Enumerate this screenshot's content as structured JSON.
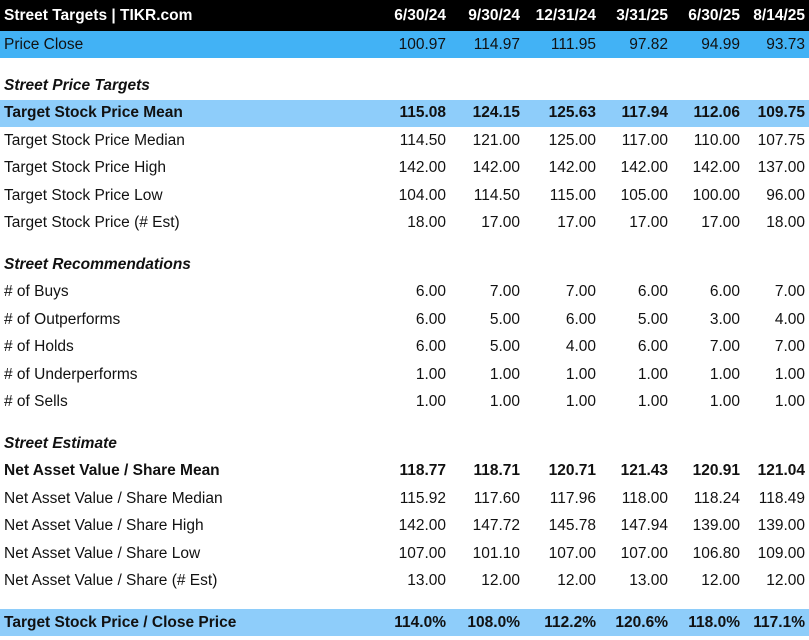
{
  "header": {
    "title": "Street Targets | TIKR.com",
    "dates": [
      "6/30/24",
      "9/30/24",
      "12/31/24",
      "3/31/25",
      "6/30/25",
      "8/14/25"
    ]
  },
  "price_close": {
    "label": "Price Close",
    "values": [
      "100.97",
      "114.97",
      "111.95",
      "97.82",
      "94.99",
      "93.73"
    ]
  },
  "price_targets": {
    "title": "Street Price Targets",
    "rows": [
      {
        "label": "Target Stock Price Mean",
        "values": [
          "115.08",
          "124.15",
          "125.63",
          "117.94",
          "112.06",
          "109.75"
        ]
      },
      {
        "label": "Target Stock Price Median",
        "values": [
          "114.50",
          "121.00",
          "125.00",
          "117.00",
          "110.00",
          "107.75"
        ]
      },
      {
        "label": "Target Stock Price High",
        "values": [
          "142.00",
          "142.00",
          "142.00",
          "142.00",
          "142.00",
          "137.00"
        ]
      },
      {
        "label": "Target Stock Price Low",
        "values": [
          "104.00",
          "114.50",
          "115.00",
          "105.00",
          "100.00",
          "96.00"
        ]
      },
      {
        "label": "Target Stock Price (# Est)",
        "values": [
          "18.00",
          "17.00",
          "17.00",
          "17.00",
          "17.00",
          "18.00"
        ]
      }
    ]
  },
  "recommendations": {
    "title": "Street Recommendations",
    "rows": [
      {
        "label": "# of Buys",
        "values": [
          "6.00",
          "7.00",
          "7.00",
          "6.00",
          "6.00",
          "7.00"
        ]
      },
      {
        "label": "# of Outperforms",
        "values": [
          "6.00",
          "5.00",
          "6.00",
          "5.00",
          "3.00",
          "4.00"
        ]
      },
      {
        "label": "# of Holds",
        "values": [
          "6.00",
          "5.00",
          "4.00",
          "6.00",
          "7.00",
          "7.00"
        ]
      },
      {
        "label": "# of Underperforms",
        "values": [
          "1.00",
          "1.00",
          "1.00",
          "1.00",
          "1.00",
          "1.00"
        ]
      },
      {
        "label": "# of Sells",
        "values": [
          "1.00",
          "1.00",
          "1.00",
          "1.00",
          "1.00",
          "1.00"
        ]
      }
    ]
  },
  "estimate": {
    "title": "Street Estimate",
    "rows": [
      {
        "label": "Net Asset Value / Share Mean",
        "values": [
          "118.77",
          "118.71",
          "120.71",
          "121.43",
          "120.91",
          "121.04"
        ]
      },
      {
        "label": "Net Asset Value / Share Median",
        "values": [
          "115.92",
          "117.60",
          "117.96",
          "118.00",
          "118.24",
          "118.49"
        ]
      },
      {
        "label": "Net Asset Value / Share High",
        "values": [
          "142.00",
          "147.72",
          "145.78",
          "147.94",
          "139.00",
          "139.00"
        ]
      },
      {
        "label": "Net Asset Value / Share Low",
        "values": [
          "107.00",
          "101.10",
          "107.00",
          "107.00",
          "106.80",
          "109.00"
        ]
      },
      {
        "label": "Net Asset Value / Share (# Est)",
        "values": [
          "13.00",
          "12.00",
          "12.00",
          "13.00",
          "12.00",
          "12.00"
        ]
      }
    ]
  },
  "target_over_close": {
    "label": "Target Stock Price / Close Price",
    "values": [
      "114.0%",
      "108.0%",
      "112.2%",
      "120.6%",
      "118.0%",
      "117.1%"
    ]
  },
  "colors": {
    "header_bg": "#000000",
    "price_bg": "#42b2f5",
    "highlight_bg": "#8ecdfa"
  }
}
